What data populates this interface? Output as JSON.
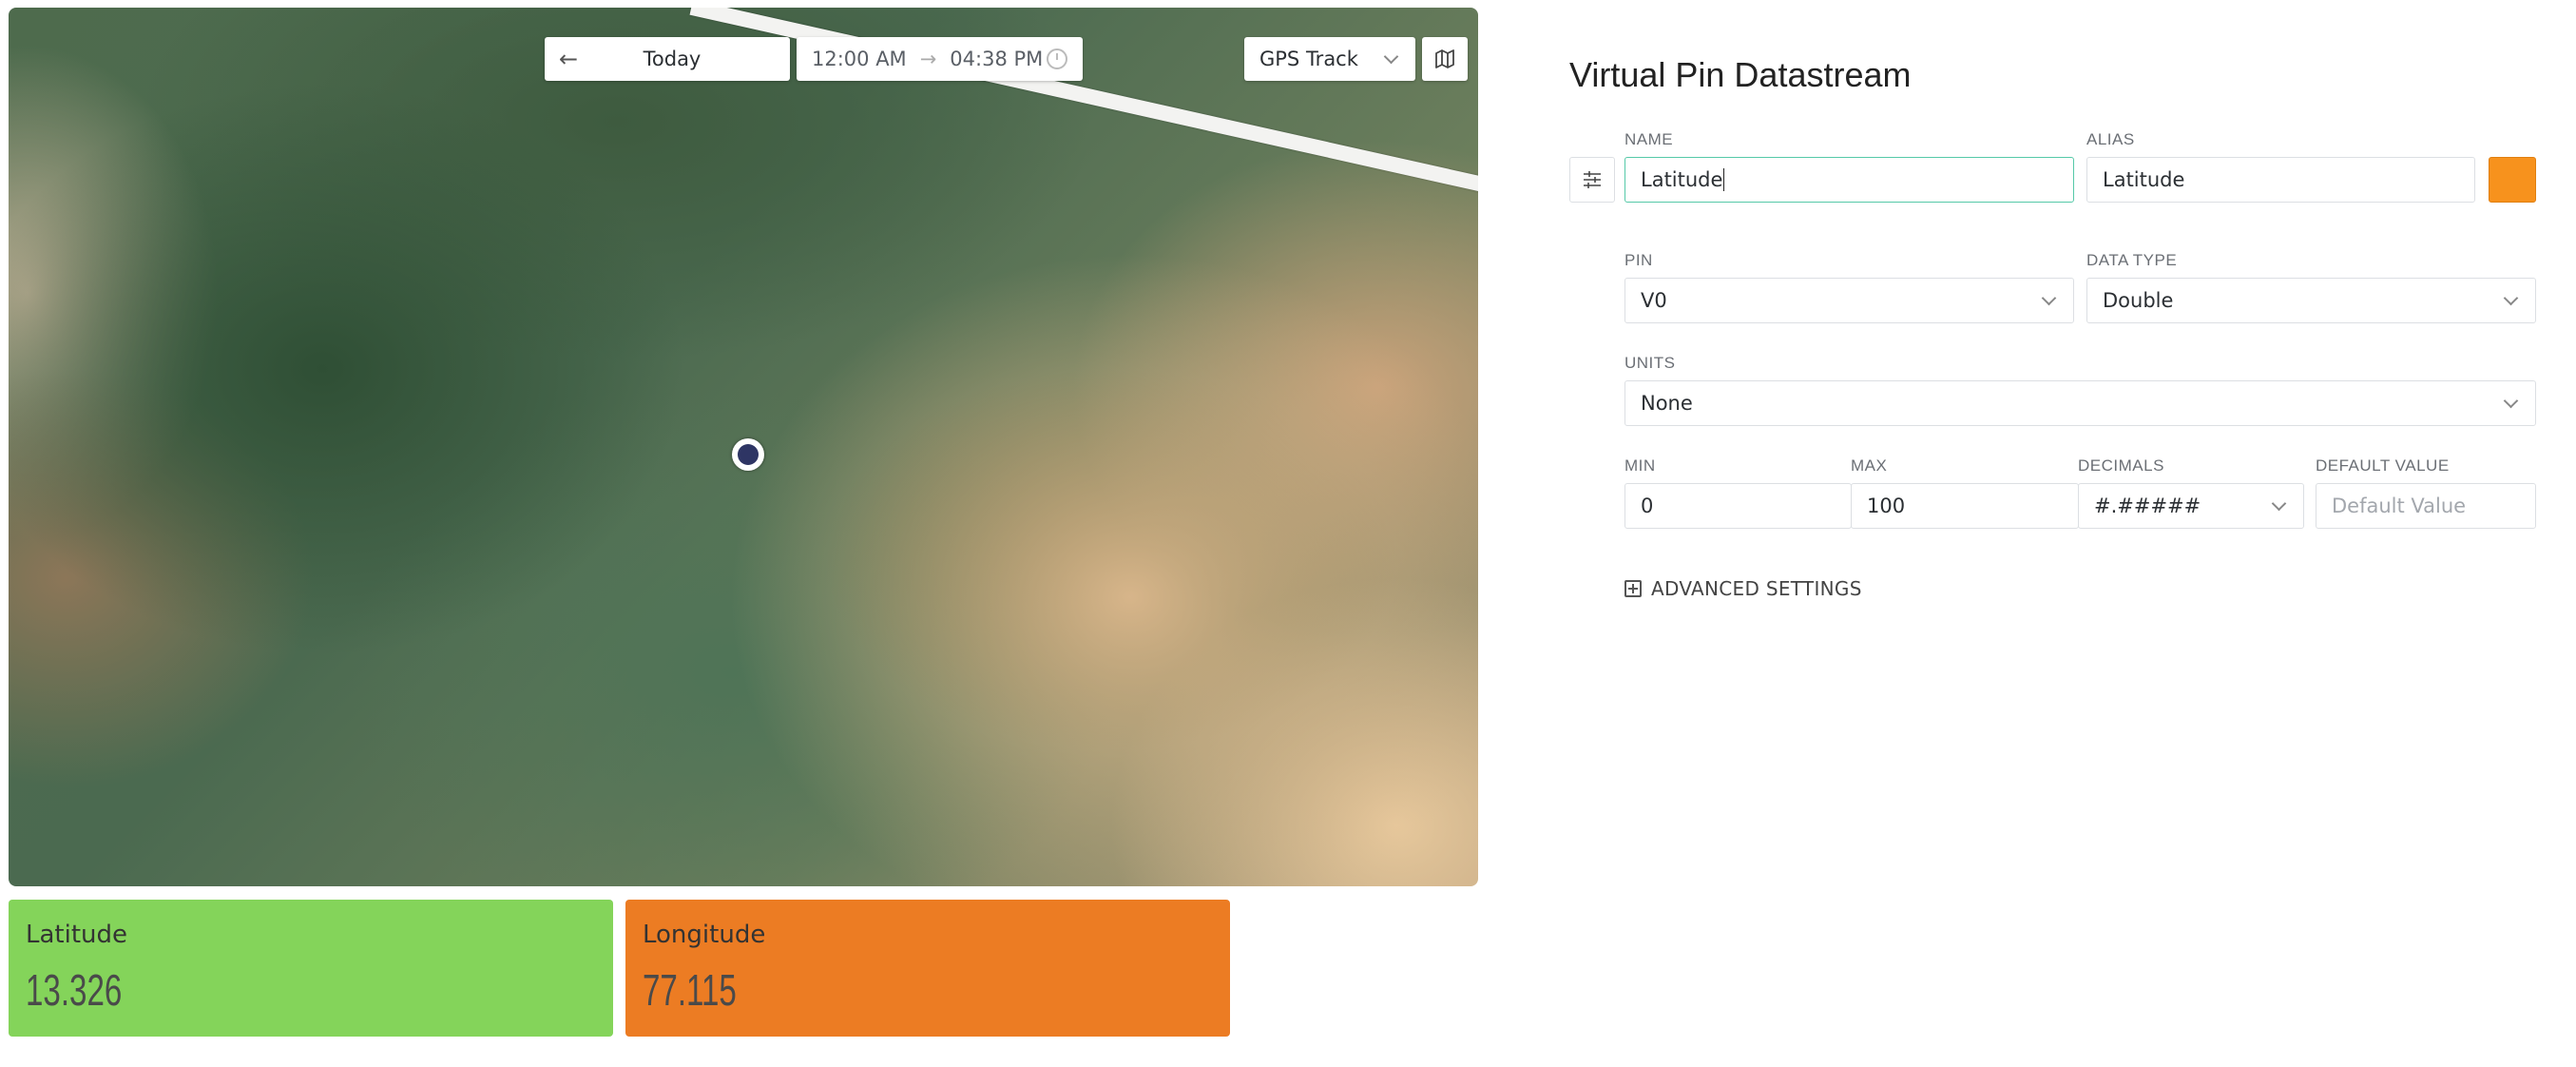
{
  "map": {
    "date_label": "Today",
    "back_arrow": "←",
    "time_from": "12:00 AM",
    "time_arrow": "→",
    "time_to": "04:38 PM",
    "layer_select": "GPS Track"
  },
  "tiles": [
    {
      "label": "Latitude",
      "value": "13.326",
      "color": "#84d45a"
    },
    {
      "label": "Longitude",
      "value": "77.115",
      "color": "#ec7c23"
    }
  ],
  "panel": {
    "title": "Virtual Pin Datastream",
    "name_label": "NAME",
    "name_value": "Latitude",
    "alias_label": "ALIAS",
    "alias_value": "Latitude",
    "color": "#f7921d",
    "pin_label": "PIN",
    "pin_value": "V0",
    "data_type_label": "DATA TYPE",
    "data_type_value": "Double",
    "units_label": "UNITS",
    "units_value": "None",
    "min_label": "MIN",
    "min_value": "0",
    "max_label": "MAX",
    "max_value": "100",
    "decimals_label": "DECIMALS",
    "decimals_value": "#.#####",
    "default_label": "DEFAULT VALUE",
    "default_placeholder": "Default Value",
    "advanced_label": "ADVANCED SETTINGS"
  }
}
